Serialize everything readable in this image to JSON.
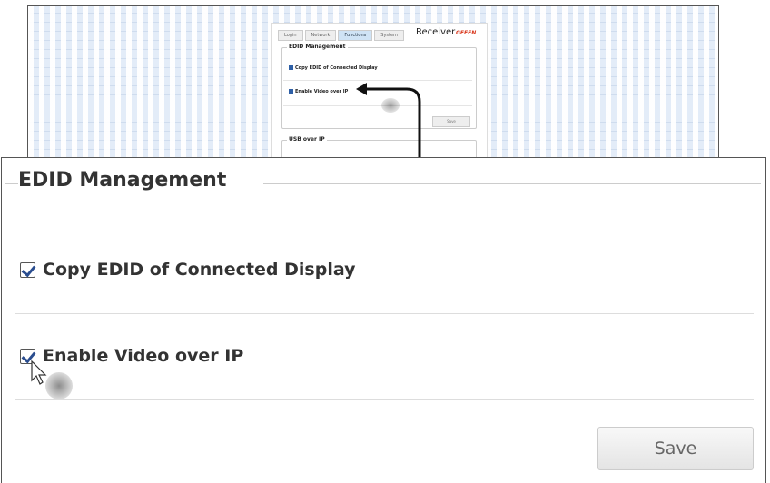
{
  "thumbnail": {
    "tabs": [
      "Login",
      "Network",
      "Functions",
      "System"
    ],
    "active_tab": "Functions",
    "device_label": "Receiver",
    "logo_text": "GEFEN",
    "edid_section": {
      "title": "EDID Management",
      "copy_edid_label": "Copy EDID of Connected Display",
      "enable_video_label": "Enable Video over IP",
      "save_label": "Save"
    },
    "usb_section": {
      "title": "USB over IP"
    }
  },
  "zoom": {
    "section_title": "EDID Management",
    "copy_edid_label": "Copy EDID of Connected Display",
    "copy_edid_checked": true,
    "enable_video_label": "Enable Video over IP",
    "enable_video_checked": true,
    "save_label": "Save"
  },
  "colors": {
    "active_tab": "#cfe3f5",
    "arrow": "#111111",
    "logo": "#d9381e",
    "checkbox": "#2a4d8f"
  }
}
